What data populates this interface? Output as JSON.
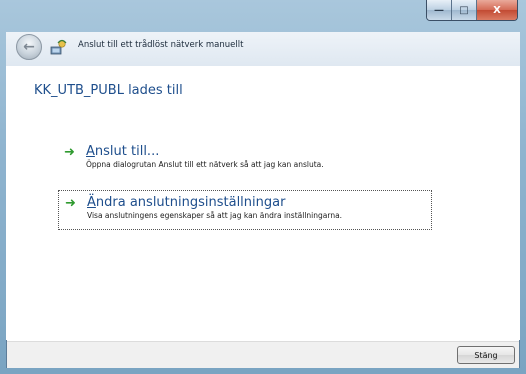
{
  "window": {
    "nav_title": "Anslut till ett trådlöst nätverk manuellt",
    "minimize": "—",
    "maximize": "□",
    "close": "X"
  },
  "main": {
    "heading": "KK_UTB_PUBL lades till",
    "options": [
      {
        "title_first": "A",
        "title_rest": "nslut till...",
        "description": "Öppna dialogrutan Anslut till ett nätverk så att jag kan ansluta.",
        "icon": "green-arrow-icon"
      },
      {
        "title_first": "Ä",
        "title_rest": "ndra anslutningsinställningar",
        "description": "Visa anslutningens egenskaper så att jag kan ändra inställningarna.",
        "icon": "green-arrow-icon"
      }
    ]
  },
  "footer": {
    "close_label": "Stäng"
  },
  "colors": {
    "link": "#1e4e8c",
    "arrow": "#2f9a2f"
  }
}
